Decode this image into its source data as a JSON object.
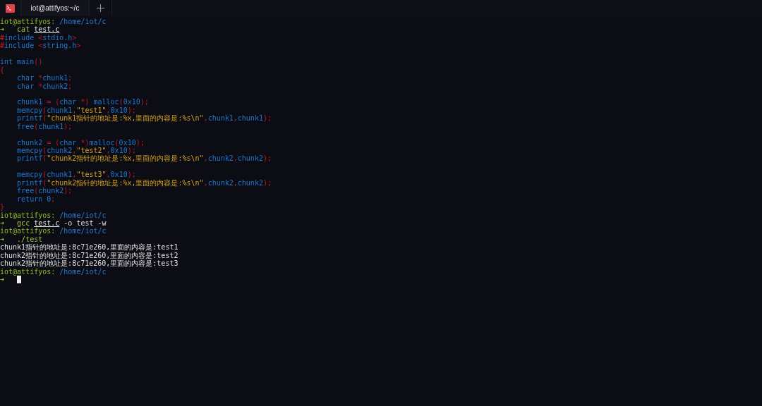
{
  "tabs": [
    {
      "title": "iot@attifyos:~/c",
      "selected": true
    }
  ],
  "lines": [
    {
      "segments": [
        {
          "kind": "user",
          "text": "iot@attifyos:"
        },
        {
          "kind": "path",
          "text": " /home/iot/c"
        }
      ]
    },
    {
      "segments": [
        {
          "kind": "arrow",
          "text": "➜"
        },
        {
          "kind": "cmd",
          "text": "   cat "
        },
        {
          "kind": "file",
          "text": "test.c"
        }
      ]
    },
    {
      "segments": [
        {
          "kind": "pre",
          "text": "#"
        },
        {
          "kind": "ident",
          "text": "include "
        },
        {
          "kind": "punct",
          "text": "<"
        },
        {
          "kind": "ident",
          "text": "stdio.h"
        },
        {
          "kind": "punct",
          "text": ">"
        }
      ]
    },
    {
      "segments": [
        {
          "kind": "pre",
          "text": "#"
        },
        {
          "kind": "ident",
          "text": "include "
        },
        {
          "kind": "punct",
          "text": "<"
        },
        {
          "kind": "ident",
          "text": "string.h"
        },
        {
          "kind": "punct",
          "text": ">"
        }
      ]
    },
    {
      "gap_before": true,
      "segments": [
        {
          "kind": "ident",
          "text": "int main"
        },
        {
          "kind": "punct",
          "text": "()"
        }
      ]
    },
    {
      "segments": [
        {
          "kind": "punct",
          "text": "{"
        }
      ]
    },
    {
      "segments": [
        {
          "kind": "ident",
          "text": "    char "
        },
        {
          "kind": "punct",
          "text": "*"
        },
        {
          "kind": "ident",
          "text": "chunk1"
        },
        {
          "kind": "punct",
          "text": ";"
        }
      ]
    },
    {
      "segments": [
        {
          "kind": "ident",
          "text": "    char "
        },
        {
          "kind": "punct",
          "text": "*"
        },
        {
          "kind": "ident",
          "text": "chunk2"
        },
        {
          "kind": "punct",
          "text": ";"
        }
      ]
    },
    {
      "gap_before": true,
      "segments": [
        {
          "kind": "ident",
          "text": "    chunk1 "
        },
        {
          "kind": "punct",
          "text": "= ("
        },
        {
          "kind": "ident",
          "text": "char "
        },
        {
          "kind": "punct",
          "text": "*) "
        },
        {
          "kind": "ident",
          "text": "malloc"
        },
        {
          "kind": "punct",
          "text": "("
        },
        {
          "kind": "ident",
          "text": "0x10"
        },
        {
          "kind": "punct",
          "text": ");"
        }
      ]
    },
    {
      "segments": [
        {
          "kind": "ident",
          "text": "    memcpy"
        },
        {
          "kind": "punct",
          "text": "("
        },
        {
          "kind": "ident",
          "text": "chunk1"
        },
        {
          "kind": "punct",
          "text": ","
        },
        {
          "kind": "string",
          "text": "\"test1\""
        },
        {
          "kind": "punct",
          "text": ","
        },
        {
          "kind": "ident",
          "text": "0x10"
        },
        {
          "kind": "punct",
          "text": ");"
        }
      ]
    },
    {
      "segments": [
        {
          "kind": "ident",
          "text": "    printf"
        },
        {
          "kind": "punct",
          "text": "("
        },
        {
          "kind": "string",
          "text": "\"chunk1指针的地址是:%x,里面的内容是:%s\\n\""
        },
        {
          "kind": "punct",
          "text": ","
        },
        {
          "kind": "ident",
          "text": "chunk1"
        },
        {
          "kind": "punct",
          "text": ","
        },
        {
          "kind": "ident",
          "text": "chunk1"
        },
        {
          "kind": "punct",
          "text": ");"
        }
      ]
    },
    {
      "segments": [
        {
          "kind": "ident",
          "text": "    free"
        },
        {
          "kind": "punct",
          "text": "("
        },
        {
          "kind": "ident",
          "text": "chunk1"
        },
        {
          "kind": "punct",
          "text": ");"
        }
      ]
    },
    {
      "gap_before": true,
      "segments": [
        {
          "kind": "ident",
          "text": "    chunk2 "
        },
        {
          "kind": "punct",
          "text": "= ("
        },
        {
          "kind": "ident",
          "text": "char "
        },
        {
          "kind": "punct",
          "text": "*)"
        },
        {
          "kind": "ident",
          "text": "malloc"
        },
        {
          "kind": "punct",
          "text": "("
        },
        {
          "kind": "ident",
          "text": "0x10"
        },
        {
          "kind": "punct",
          "text": ");"
        }
      ]
    },
    {
      "segments": [
        {
          "kind": "ident",
          "text": "    memcpy"
        },
        {
          "kind": "punct",
          "text": "("
        },
        {
          "kind": "ident",
          "text": "chunk2"
        },
        {
          "kind": "punct",
          "text": ","
        },
        {
          "kind": "string",
          "text": "\"test2\""
        },
        {
          "kind": "punct",
          "text": ","
        },
        {
          "kind": "ident",
          "text": "0x10"
        },
        {
          "kind": "punct",
          "text": ");"
        }
      ]
    },
    {
      "segments": [
        {
          "kind": "ident",
          "text": "    printf"
        },
        {
          "kind": "punct",
          "text": "("
        },
        {
          "kind": "string",
          "text": "\"chunk2指针的地址是:%x,里面的内容是:%s\\n\""
        },
        {
          "kind": "punct",
          "text": ","
        },
        {
          "kind": "ident",
          "text": "chunk2"
        },
        {
          "kind": "punct",
          "text": ","
        },
        {
          "kind": "ident",
          "text": "chunk2"
        },
        {
          "kind": "punct",
          "text": ");"
        }
      ]
    },
    {
      "gap_before": true,
      "segments": [
        {
          "kind": "ident",
          "text": "    memcpy"
        },
        {
          "kind": "punct",
          "text": "("
        },
        {
          "kind": "ident",
          "text": "chunk1"
        },
        {
          "kind": "punct",
          "text": ","
        },
        {
          "kind": "string",
          "text": "\"test3\""
        },
        {
          "kind": "punct",
          "text": ","
        },
        {
          "kind": "ident",
          "text": "0x10"
        },
        {
          "kind": "punct",
          "text": ");"
        }
      ]
    },
    {
      "segments": [
        {
          "kind": "ident",
          "text": "    printf"
        },
        {
          "kind": "punct",
          "text": "("
        },
        {
          "kind": "string",
          "text": "\"chunk2指针的地址是:%x,里面的内容是:%s\\n\""
        },
        {
          "kind": "punct",
          "text": ","
        },
        {
          "kind": "ident",
          "text": "chunk2"
        },
        {
          "kind": "punct",
          "text": ","
        },
        {
          "kind": "ident",
          "text": "chunk2"
        },
        {
          "kind": "punct",
          "text": ");"
        }
      ]
    },
    {
      "segments": [
        {
          "kind": "ident",
          "text": "    free"
        },
        {
          "kind": "punct",
          "text": "("
        },
        {
          "kind": "ident",
          "text": "chunk2"
        },
        {
          "kind": "punct",
          "text": ");"
        }
      ]
    },
    {
      "segments": [
        {
          "kind": "ident",
          "text": "    return 0"
        },
        {
          "kind": "punct",
          "text": ";"
        }
      ]
    },
    {
      "segments": [
        {
          "kind": "punct",
          "text": "}"
        }
      ]
    },
    {
      "segments": [
        {
          "kind": "user",
          "text": "iot@attifyos:"
        },
        {
          "kind": "path",
          "text": " /home/iot/c"
        }
      ]
    },
    {
      "segments": [
        {
          "kind": "arrow",
          "text": "➜"
        },
        {
          "kind": "cmd",
          "text": "   gcc "
        },
        {
          "kind": "file",
          "text": "test.c"
        },
        {
          "kind": "output",
          "text": " -o test -w"
        }
      ]
    },
    {
      "segments": [
        {
          "kind": "user",
          "text": "iot@attifyos:"
        },
        {
          "kind": "path",
          "text": " /home/iot/c"
        }
      ]
    },
    {
      "segments": [
        {
          "kind": "arrow",
          "text": "➜"
        },
        {
          "kind": "cmd",
          "text": "   ./test"
        }
      ]
    },
    {
      "segments": [
        {
          "kind": "output",
          "text": "chunk1指针的地址是:8c71e260,里面的内容是:test1"
        }
      ]
    },
    {
      "segments": [
        {
          "kind": "output",
          "text": "chunk2指针的地址是:8c71e260,里面的内容是:test2"
        }
      ]
    },
    {
      "segments": [
        {
          "kind": "output",
          "text": "chunk2指针的地址是:8c71e260,里面的内容是:test3"
        }
      ]
    },
    {
      "segments": [
        {
          "kind": "user",
          "text": "iot@attifyos:"
        },
        {
          "kind": "path",
          "text": " /home/iot/c"
        }
      ]
    },
    {
      "segments": [
        {
          "kind": "arrow",
          "text": "➜"
        },
        {
          "kind": "cursor"
        }
      ]
    }
  ]
}
